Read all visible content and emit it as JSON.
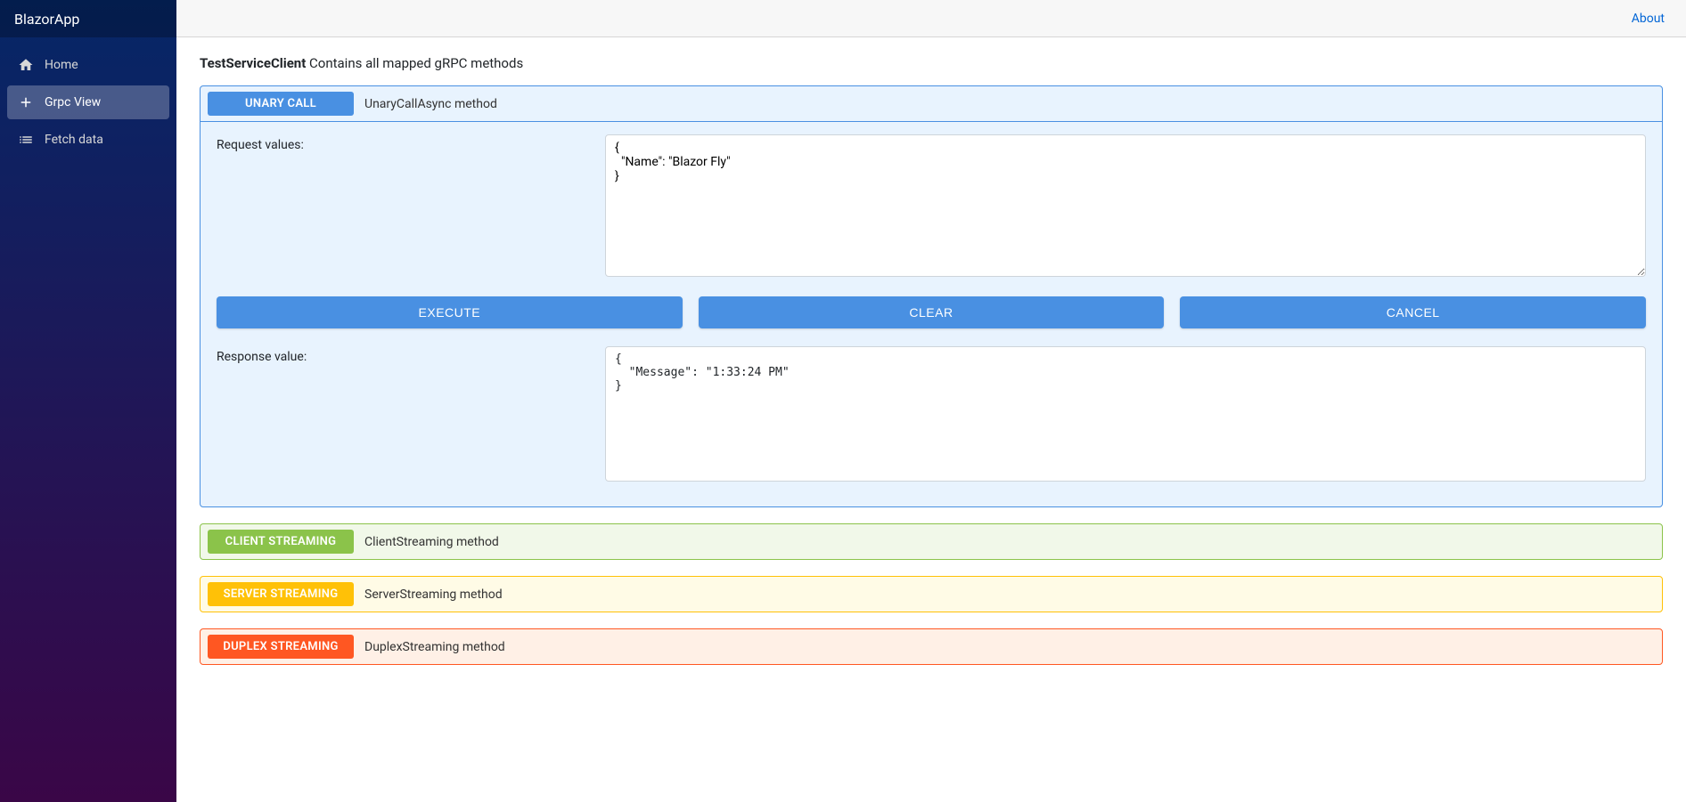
{
  "sidebar": {
    "brand": "BlazorApp",
    "items": [
      {
        "label": "Home"
      },
      {
        "label": "Grpc View"
      },
      {
        "label": "Fetch data"
      }
    ]
  },
  "topbar": {
    "about": "About"
  },
  "page": {
    "service_name": "TestServiceClient",
    "service_desc": "Contains all mapped gRPC methods"
  },
  "unary": {
    "badge": "UNARY CALL",
    "desc": "UnaryCallAsync method",
    "request_label": "Request values:",
    "request_value": "{\n  \"Name\": \"Blazor Fly\"\n}",
    "execute": "EXECUTE",
    "clear": "CLEAR",
    "cancel": "CANCEL",
    "response_label": "Response value:",
    "response_value": "{\n  \"Message\": \"1:33:24 PM\"\n}"
  },
  "client_streaming": {
    "badge": "CLIENT STREAMING",
    "desc": "ClientStreaming method"
  },
  "server_streaming": {
    "badge": "SERVER STREAMING",
    "desc": "ServerStreaming method"
  },
  "duplex_streaming": {
    "badge": "DUPLEX STREAMING",
    "desc": "DuplexStreaming method"
  }
}
